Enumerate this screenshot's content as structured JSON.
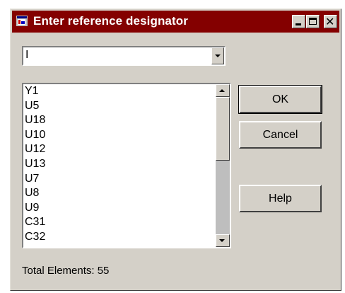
{
  "window": {
    "title": "Enter reference designator",
    "icon": "app-window-icon",
    "controls": {
      "minimize": "minimize-icon",
      "maximize": "maximize-icon",
      "close": "close-icon",
      "close_glyph": "✕"
    }
  },
  "combo": {
    "value": "I",
    "icon": "chevron-down-icon"
  },
  "list": {
    "items": [
      "Y1",
      "U5",
      "U18",
      "U10",
      "U12",
      "U13",
      "U7",
      "U8",
      "U9",
      "C31",
      "C32"
    ]
  },
  "buttons": {
    "ok": "OK",
    "cancel": "Cancel",
    "help": "Help"
  },
  "status": {
    "total_label": "Total Elements: 55"
  },
  "colors": {
    "titlebar": "#840000",
    "dialog_face": "#d4d0c8"
  }
}
